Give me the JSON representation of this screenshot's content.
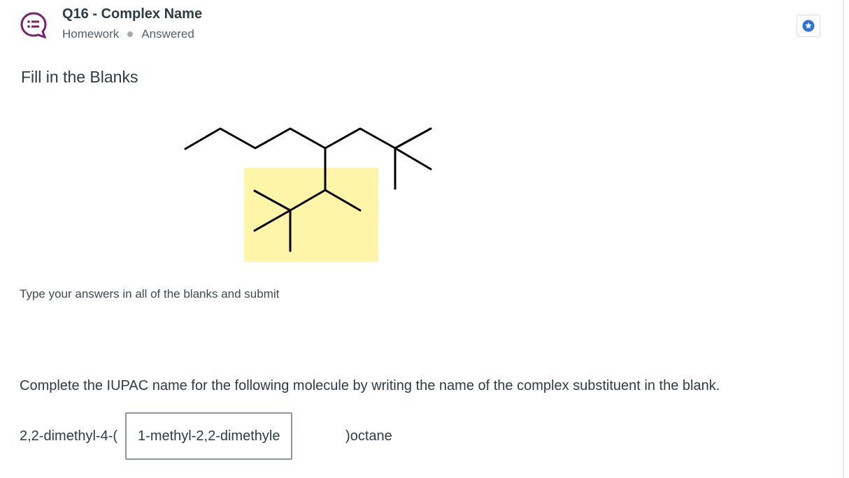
{
  "header": {
    "title": "Q16 - Complex Name",
    "type": "Homework",
    "status": "Answered",
    "icon": "question-list-icon",
    "accent_color": "#7a1f6e"
  },
  "bookmark": {
    "icon": "star-badge-icon",
    "color": "#2d72d9"
  },
  "section_title": "Fill in the Blanks",
  "figure": {
    "highlight_color": "#fff5a8",
    "description_icon": "skeletal-structure"
  },
  "instructions": "Type your answers in all of the blanks and submit",
  "prompt": "Complete the IUPAC name for the following molecule by writing the name of the complex substituent in the blank.",
  "answer": {
    "prefix": "2,2-dimethyl-4-(",
    "value": "1-methyl-2,2-dimethylethyl",
    "suffix": ")octane"
  }
}
